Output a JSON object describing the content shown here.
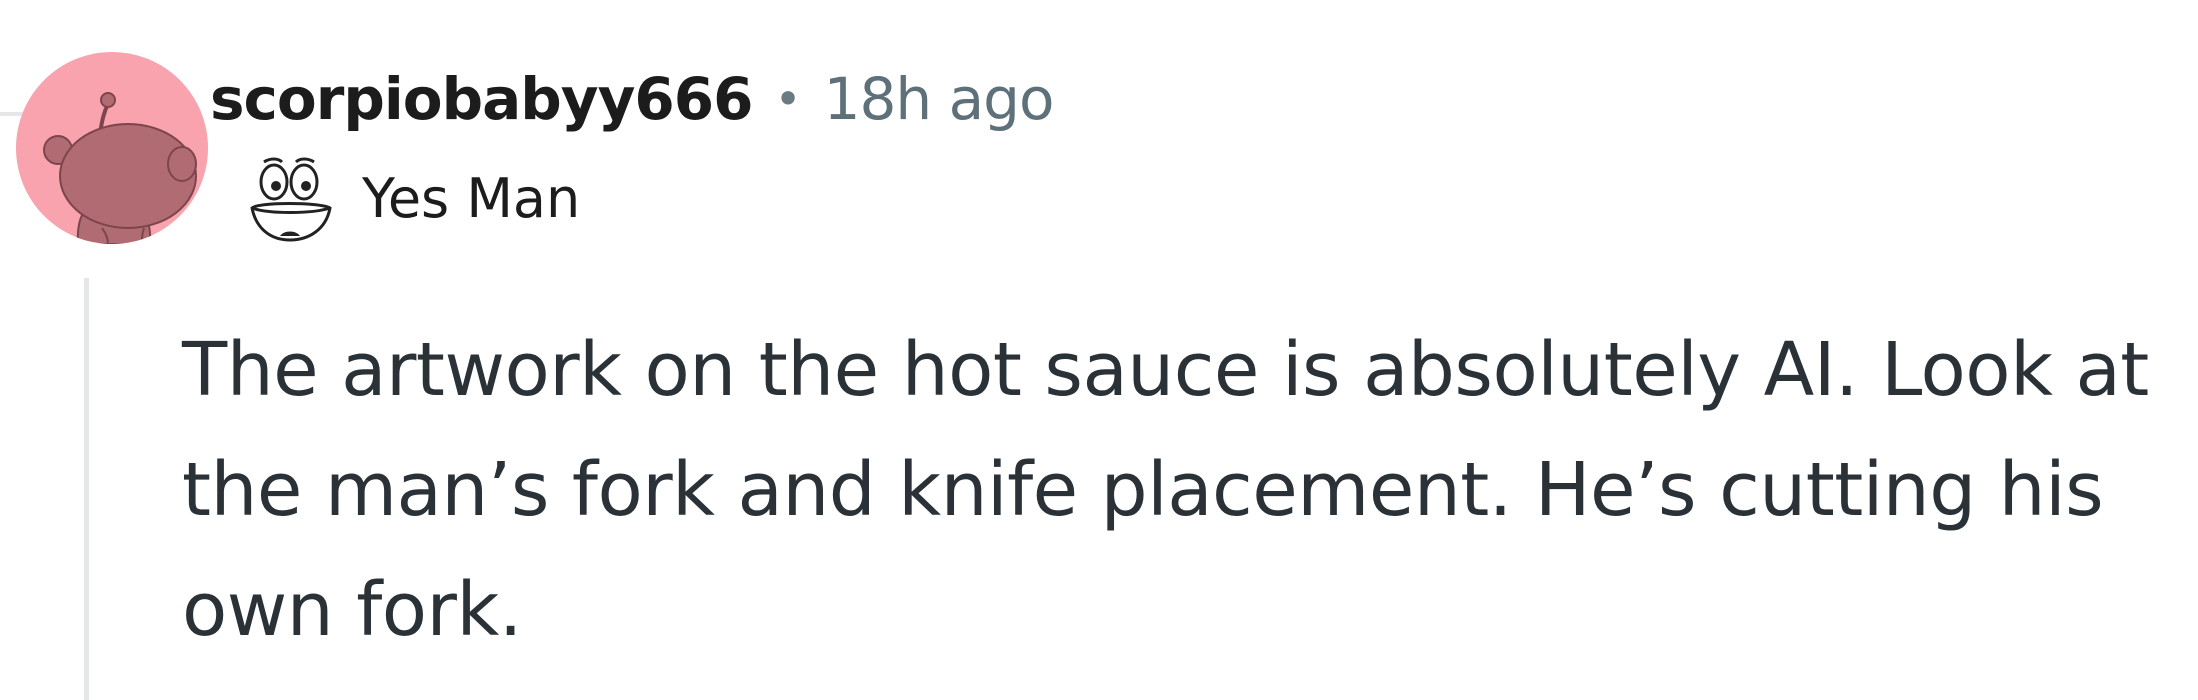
{
  "comment": {
    "username": "scorpiobabyy666",
    "separator": "•",
    "timestamp": "18h ago",
    "flair_text": "Yes Man",
    "body": "The artwork on the hot sauce is absolutely AI. Look at the man’s fork and knife placement. He’s cutting his own fork."
  },
  "colors": {
    "avatar_background": "#f8a3ae",
    "avatar_figure": "#b06b73",
    "thread_line": "#e4e6e8",
    "username": "#1c1c1c",
    "timestamp": "#5e7079",
    "body_text": "#2a3238"
  },
  "icons": {
    "avatar": "reddit-snoo-avatar",
    "flair": "yes-man-face-emoji"
  }
}
